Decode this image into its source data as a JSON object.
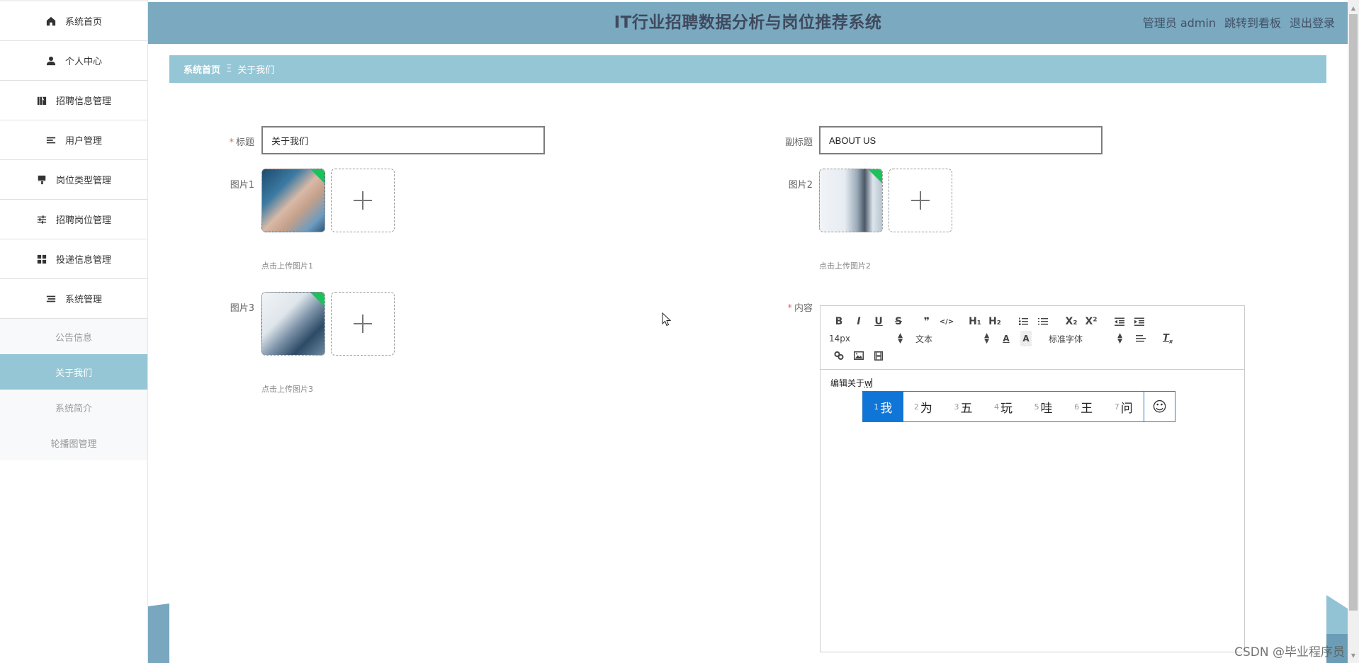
{
  "app": {
    "title": "IT行业招聘数据分析与岗位推荐系统",
    "user_label": "管理员 admin",
    "dashboard_link": "跳转到看板",
    "logout_link": "退出登录"
  },
  "sidebar": {
    "items": [
      {
        "label": "系统首页",
        "icon": "home-icon"
      },
      {
        "label": "个人中心",
        "icon": "user-icon"
      },
      {
        "label": "招聘信息管理",
        "icon": "chart-icon"
      },
      {
        "label": "用户管理",
        "icon": "list-icon"
      },
      {
        "label": "岗位类型管理",
        "icon": "brush-icon"
      },
      {
        "label": "招聘岗位管理",
        "icon": "sliders-icon"
      },
      {
        "label": "投递信息管理",
        "icon": "grid-icon"
      },
      {
        "label": "系统管理",
        "icon": "list-icon"
      }
    ],
    "submenu": [
      {
        "label": "公告信息",
        "active": false
      },
      {
        "label": "关于我们",
        "active": true
      },
      {
        "label": "系统简介",
        "active": false
      },
      {
        "label": "轮播图管理",
        "active": false
      }
    ]
  },
  "breadcrumb": {
    "home": "系统首页",
    "separator": "Ξ",
    "current": "关于我们"
  },
  "form": {
    "title_label": "标题",
    "title_value": "关于我们",
    "subtitle_label": "副标题",
    "subtitle_value": "ABOUT US",
    "image1_label": "图片1",
    "image1_hint": "点击上传图片1",
    "image2_label": "图片2",
    "image2_hint": "点击上传图片2",
    "image3_label": "图片3",
    "image3_hint": "点击上传图片3",
    "content_label": "内容",
    "required_mark": "*"
  },
  "editor": {
    "toolbar_row1": [
      "B",
      "I",
      "U",
      "S",
      "❞",
      "</>",
      "H₁",
      "H₂",
      "ordered-list",
      "bullet-list",
      "X₂",
      "X²",
      "outdent",
      "indent"
    ],
    "font_size": "14px",
    "text_type": "文本",
    "font_family": "标准字体",
    "content_text": "编辑关于",
    "composing_text": "w"
  },
  "ime": {
    "candidates": [
      {
        "num": "1",
        "char": "我",
        "selected": true
      },
      {
        "num": "2",
        "char": "为",
        "selected": false
      },
      {
        "num": "3",
        "char": "五",
        "selected": false
      },
      {
        "num": "4",
        "char": "玩",
        "selected": false
      },
      {
        "num": "5",
        "char": "哇",
        "selected": false
      },
      {
        "num": "6",
        "char": "王",
        "selected": false
      },
      {
        "num": "7",
        "char": "问",
        "selected": false
      }
    ],
    "emoji": "☺"
  },
  "colors": {
    "header_bg": "#7aa9c0",
    "breadcrumb_bg": "#95c6d5",
    "active_menu_bg": "#95c6d5",
    "ime_selected": "#0f75d6",
    "badge_green": "#1dc15b"
  },
  "watermark": "CSDN @毕业程序员"
}
